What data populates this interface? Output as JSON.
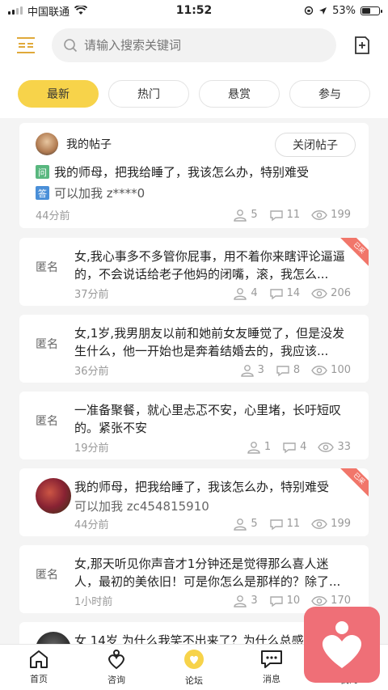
{
  "status_bar": {
    "carrier": "中国联通",
    "time": "11:52",
    "battery": "53%",
    "battery_level": 0.53
  },
  "search": {
    "placeholder": "请输入搜索关键词"
  },
  "tabs": [
    {
      "label": "最新",
      "active": true
    },
    {
      "label": "热门",
      "active": false
    },
    {
      "label": "悬赏",
      "active": false
    },
    {
      "label": "参与",
      "active": false
    }
  ],
  "my_post": {
    "header": "我的帖子",
    "close_label": "关闭帖子",
    "q_tag": "问",
    "question": "我的师母，把我给睡了，我该怎么办，特别难受",
    "a_tag": "答",
    "answer": "可以加我 z****0",
    "time": "44分前",
    "likes": "5",
    "comments": "11",
    "views": "199"
  },
  "posts": [
    {
      "author": "匿名",
      "text": "女,我心事多不多管你屁事，用不着你来瞎评论逼逼的，不会说话给老子他妈的闭嘴，滚，我怎么...",
      "time": "37分前",
      "likes": "4",
      "comments": "14",
      "views": "206",
      "ribbon": "已采"
    },
    {
      "author": "匿名",
      "text": "女,1岁,我男朋友以前和她前女友睡觉了，但是没发生什么，他一开始也是奔着结婚去的，我应该...",
      "time": "36分前",
      "likes": "3",
      "comments": "8",
      "views": "100"
    },
    {
      "author": "匿名",
      "text": "一准备聚餐，就心里忐忑不安，心里堵，长吁短叹的。紧张不安",
      "time": "19分前",
      "likes": "1",
      "comments": "4",
      "views": "33"
    },
    {
      "author": "",
      "text": "我的师母，把我给睡了，我该怎么办，特别难受",
      "subtext": "可以加我 zc454815910",
      "time": "44分前",
      "likes": "5",
      "comments": "11",
      "views": "199",
      "ribbon": "已采"
    },
    {
      "author": "匿名",
      "text": "女,那天听见你声音才1分钟还是觉得那么喜人迷人，最初的美依旧！可是你怎么是那样的？除了...",
      "time": "1小时前",
      "likes": "3",
      "comments": "10",
      "views": "170"
    },
    {
      "author": "",
      "text": "女 14岁 为什么我笑不出来了？为什么总感",
      "time": "",
      "likes": "",
      "comments": "",
      "views": ""
    }
  ],
  "tabbar": [
    {
      "label": "首页",
      "icon": "home-icon"
    },
    {
      "label": "咨询",
      "icon": "heart-person-icon"
    },
    {
      "label": "论坛",
      "icon": "forum-icon"
    },
    {
      "label": "消息",
      "icon": "message-icon"
    },
    {
      "label": "我的",
      "icon": "profile-icon"
    }
  ],
  "colors": {
    "accent": "#f7d34a",
    "ribbon": "#f1766a",
    "float_button": "#ef6f77"
  }
}
